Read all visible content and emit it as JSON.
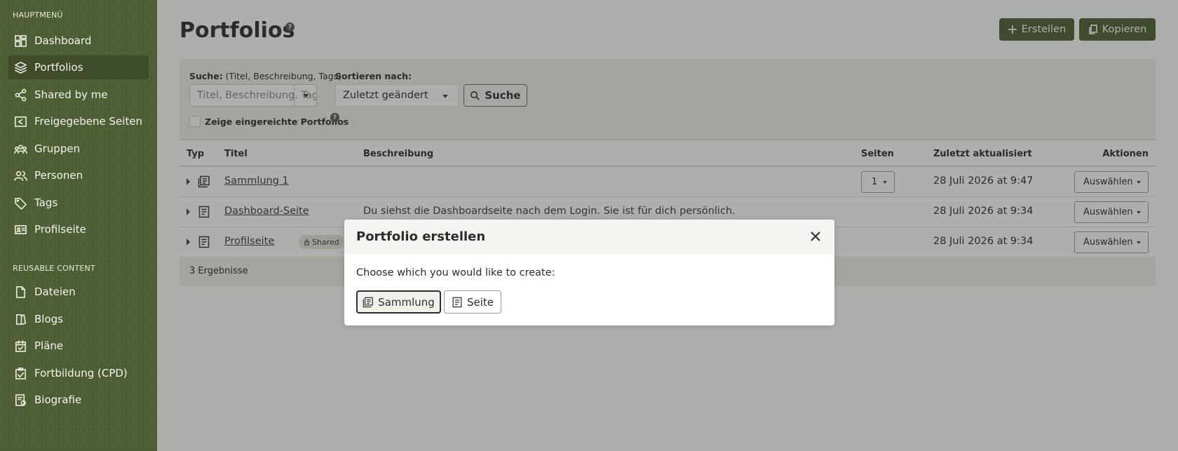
{
  "sidebar": {
    "section_main": "HAUPTMENÜ",
    "section_reusable": "REUSABLE CONTENT",
    "items": [
      {
        "label": "Dashboard",
        "icon": "dashboard-icon"
      },
      {
        "label": "Portfolios",
        "icon": "layers-icon",
        "active": true
      },
      {
        "label": "Shared by me",
        "icon": "share-icon"
      },
      {
        "label": "Freigegebene Seiten",
        "icon": "shared-pages-icon"
      },
      {
        "label": "Gruppen",
        "icon": "groups-icon"
      },
      {
        "label": "Personen",
        "icon": "people-icon"
      },
      {
        "label": "Tags",
        "icon": "tag-icon"
      },
      {
        "label": "Profilseite",
        "icon": "profile-card-icon"
      }
    ],
    "reusable_items": [
      {
        "label": "Dateien",
        "icon": "file-icon"
      },
      {
        "label": "Blogs",
        "icon": "blog-icon"
      },
      {
        "label": "Pläne",
        "icon": "plan-icon"
      },
      {
        "label": "Fortbildung (CPD)",
        "icon": "clipboard-check-icon"
      },
      {
        "label": "Biografie",
        "icon": "biography-icon"
      }
    ]
  },
  "header": {
    "title": "Portfolios",
    "help": "?",
    "create_label": "Erstellen",
    "copy_label": "Kopieren"
  },
  "search": {
    "search_label_bold": "Suche:",
    "search_label_hint": "(Titel, Beschreibung, Tags)",
    "search_placeholder": "Titel, Beschreibung, Tags",
    "sort_label": "Sortieren nach:",
    "sort_value": "Zuletzt geändert",
    "search_button": "Suche",
    "show_submitted_label": "Zeige eingereichte Portfolios",
    "help": "?"
  },
  "table": {
    "columns": {
      "type": "Typ",
      "title": "Titel",
      "description": "Beschreibung",
      "pages": "Seiten",
      "updated": "Zuletzt aktualisiert",
      "actions": "Aktionen"
    },
    "rows": [
      {
        "type_icon": "collection-icon",
        "title": "Sammlung 1",
        "description": "",
        "pages": "1",
        "updated": "28 Juli 2026 at 9:47",
        "action": "Auswählen"
      },
      {
        "type_icon": "page-icon",
        "title": "Dashboard-Seite",
        "description": "Du siehst die Dashboardseite nach dem Login. Sie ist für dich persönlich.",
        "pages": "",
        "updated": "28 Juli 2026 at 9:34",
        "action": "Auswählen"
      },
      {
        "type_icon": "page-icon",
        "title": "Profilseite",
        "badge": "Shared",
        "description": "",
        "pages": "",
        "updated": "28 Juli 2026 at 9:34",
        "action": "Auswählen"
      }
    ],
    "results": "3 Ergebnisse"
  },
  "modal": {
    "title": "Portfolio erstellen",
    "prompt": "Choose which you would like to create:",
    "collection_button": "Sammlung",
    "page_button": "Seite"
  },
  "colors": {
    "brand": "#4e5e34",
    "sidebar_active": "#3f4c29",
    "panel": "#eef0e8"
  }
}
